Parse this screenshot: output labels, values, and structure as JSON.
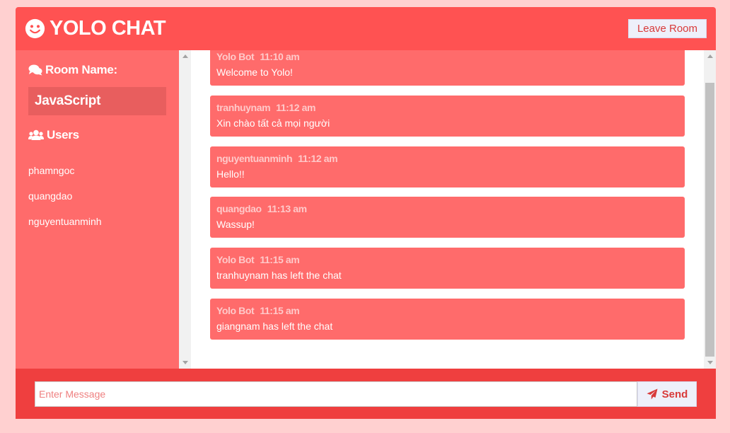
{
  "header": {
    "title": "YOLO CHAT",
    "leave_label": "Leave Room"
  },
  "sidebar": {
    "room_heading": "Room Name:",
    "room_name": "JavaScript",
    "users_heading": "Users",
    "users": [
      "phamngoc",
      "quangdao",
      "nguyentuanminh"
    ]
  },
  "messages": [
    {
      "user": "Yolo Bot",
      "time": "11:10 am",
      "text": "Welcome to Yolo!"
    },
    {
      "user": "tranhuynam",
      "time": "11:12 am",
      "text": "Xin chào tất cả mọi người"
    },
    {
      "user": "nguyentuanminh",
      "time": "11:12 am",
      "text": "Hello!!"
    },
    {
      "user": "quangdao",
      "time": "11:13 am",
      "text": "Wassup!"
    },
    {
      "user": "Yolo Bot",
      "time": "11:15 am",
      "text": "tranhuynam has left the chat"
    },
    {
      "user": "Yolo Bot",
      "time": "11:15 am",
      "text": "giangnam has left the chat"
    }
  ],
  "footer": {
    "input_placeholder": "Enter Message",
    "input_value": "",
    "send_label": "Send"
  },
  "colors": {
    "page_background": "#ffd0d0",
    "header": "#ff5252",
    "sidebar": "#ff6b6b",
    "message_bubble": "#ff6b6b",
    "footer": "#ef3f3f",
    "button_text": "#d83a3a"
  },
  "icons": {
    "logo": "smile-icon",
    "room": "comments-icon",
    "users": "users-icon",
    "send": "paper-plane-icon"
  }
}
